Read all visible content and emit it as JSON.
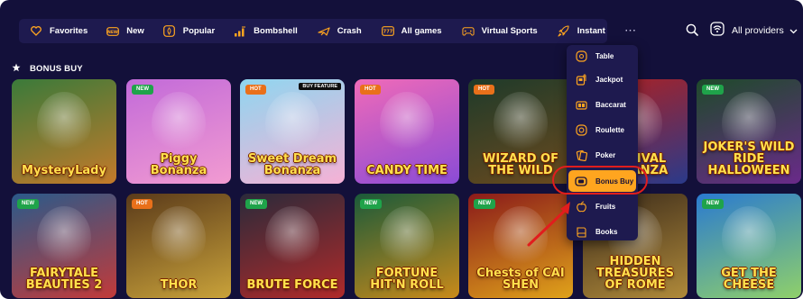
{
  "nav": {
    "items": [
      {
        "label": "Favorites",
        "icon": "heart-icon"
      },
      {
        "label": "New",
        "icon": "new-icon"
      },
      {
        "label": "Popular",
        "icon": "popular-icon"
      },
      {
        "label": "Bombshell",
        "icon": "bombshell-icon"
      },
      {
        "label": "Crash",
        "icon": "plane-icon"
      },
      {
        "label": "All games",
        "icon": "all-games-icon"
      },
      {
        "label": "Virtual Sports",
        "icon": "gamepad-icon"
      },
      {
        "label": "Instant",
        "icon": "rocket-icon"
      },
      {
        "label": "···",
        "icon": "more-icon"
      }
    ]
  },
  "providers": {
    "label": "All providers"
  },
  "section": {
    "title": "BONUS BUY"
  },
  "badges": {
    "new": "NEW",
    "hot": "HOT",
    "buy_feature": "BUY FEATURE"
  },
  "cards": [
    {
      "title": "MysteryLady",
      "badge": "",
      "colors": [
        "#3a7a3a",
        "#c47a2a"
      ]
    },
    {
      "title": "Piggy Bonanza",
      "badge": "NEW",
      "colors": [
        "#c26ad9",
        "#f29bd1"
      ]
    },
    {
      "title": "Sweet Dream Bonanza",
      "badge": "HOT",
      "colors": [
        "#8fd6f0",
        "#f6b1d5"
      ]
    },
    {
      "title": "CANDY TIME",
      "badge": "HOT",
      "colors": [
        "#f06ab8",
        "#8a4bd6"
      ]
    },
    {
      "title": "WIZARD OF THE WILD",
      "badge": "HOT",
      "colors": [
        "#1e3a2a",
        "#6b4a1e"
      ]
    },
    {
      "title": "FESTIVAL BONANZA",
      "badge": "",
      "colors": [
        "#b02020",
        "#2a3a8a"
      ]
    },
    {
      "title": "JOKER'S WILD RIDE HALLOWEEN",
      "badge": "NEW",
      "colors": [
        "#1e4a2a",
        "#6a2a8a"
      ]
    },
    {
      "title": "FAIRYTALE BEAUTIES 2",
      "badge": "NEW",
      "colors": [
        "#2a5a8a",
        "#c23a3a"
      ]
    },
    {
      "title": "THOR",
      "badge": "HOT",
      "colors": [
        "#5a3a1a",
        "#c9a23a"
      ]
    },
    {
      "title": "BRUTE FORCE",
      "badge": "NEW",
      "colors": [
        "#2a2a3a",
        "#b02a2a"
      ]
    },
    {
      "title": "FORTUNE HIT'N ROLL",
      "badge": "NEW",
      "colors": [
        "#1a5a3a",
        "#c98a1a"
      ]
    },
    {
      "title": "Chests of CAI SHEN",
      "badge": "NEW",
      "colors": [
        "#8a1a1a",
        "#e0a21a"
      ]
    },
    {
      "title": "HIDDEN TREASURES OF ROME",
      "badge": "",
      "colors": [
        "#3a2a1a",
        "#b08a3a"
      ]
    },
    {
      "title": "GET THE CHEESE",
      "badge": "NEW",
      "colors": [
        "#2a7ad0",
        "#8fd06a"
      ]
    }
  ],
  "dropdown": {
    "items": [
      {
        "label": "Table",
        "icon": "table-icon"
      },
      {
        "label": "Jackpot",
        "icon": "jackpot-icon"
      },
      {
        "label": "Baccarat",
        "icon": "baccarat-icon"
      },
      {
        "label": "Roulette",
        "icon": "roulette-icon"
      },
      {
        "label": "Poker",
        "icon": "poker-icon"
      },
      {
        "label": "Bonus Buy",
        "icon": "bonus-buy-icon",
        "active": true
      },
      {
        "label": "Fruits",
        "icon": "fruits-icon"
      },
      {
        "label": "Books",
        "icon": "books-icon"
      }
    ]
  },
  "colors": {
    "background": "#13103a",
    "nav_bg": "#1e1a4f",
    "active_accent": "#ffa51f",
    "annotation_red": "#e11d1d"
  }
}
